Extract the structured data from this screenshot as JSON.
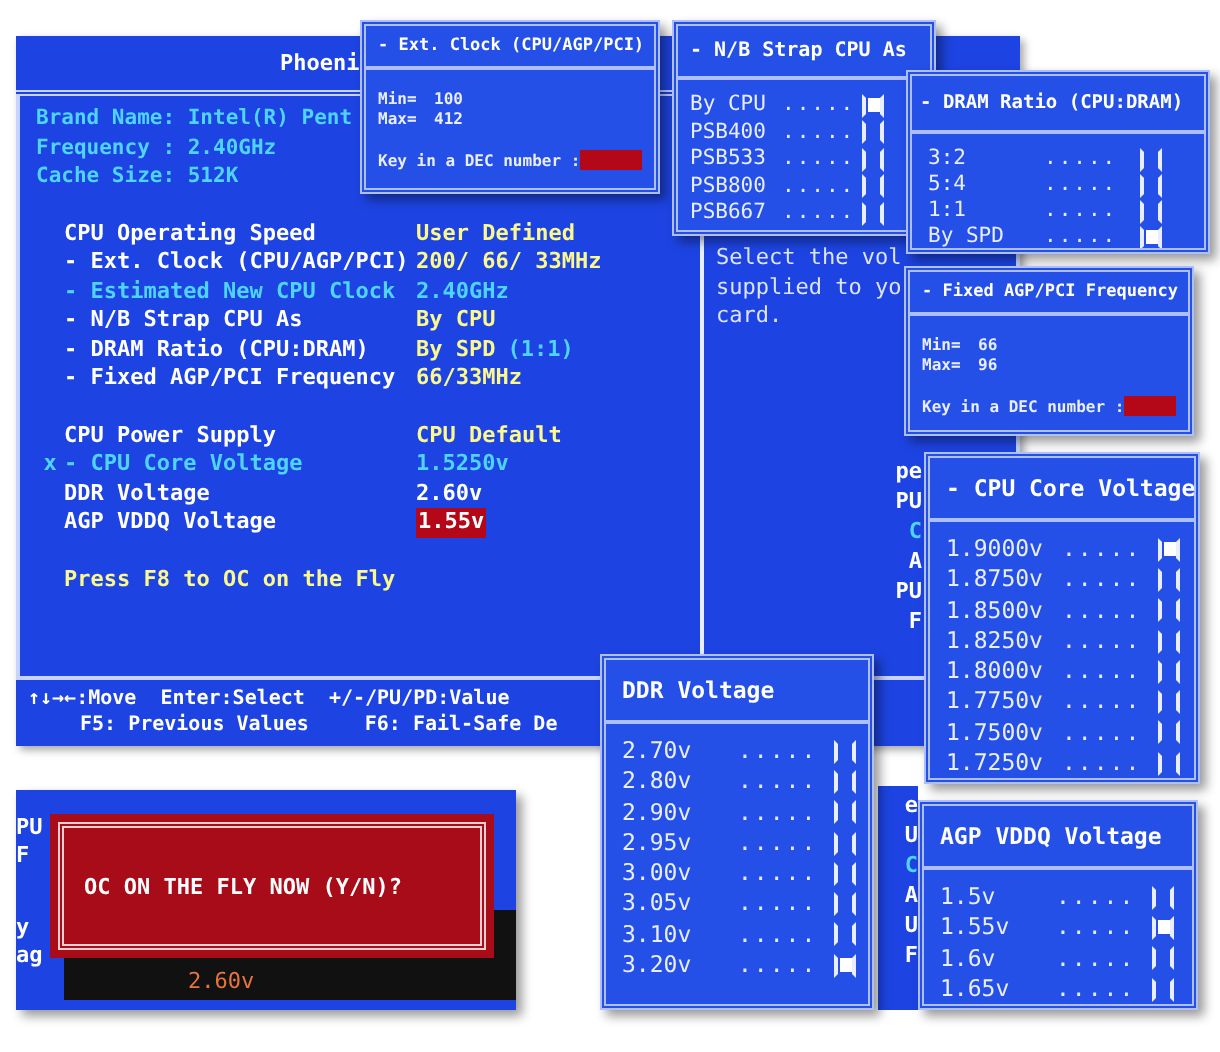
{
  "main_screen": {
    "header": "Phoeni",
    "cpu_info": [
      "Brand Name: Intel(R) Pent",
      "Frequency : 2.40GHz",
      "Cache Size:  512K"
    ],
    "settings_groups": [
      [
        {
          "label": "CPU Operating Speed",
          "value": "User Defined",
          "kind": "option",
          "disabled": false,
          "selected": false
        },
        {
          "label": "- Ext. Clock (CPU/AGP/PCI)",
          "value": "200/ 66/ 33MHz",
          "kind": "option",
          "disabled": false,
          "selected": false
        },
        {
          "label": "- Estimated New CPU Clock",
          "value": "2.40GHz",
          "kind": "option",
          "disabled": true,
          "selected": false
        },
        {
          "label": "- N/B Strap CPU As",
          "value": "By CPU",
          "kind": "option",
          "disabled": false,
          "selected": false
        },
        {
          "label": "- DRAM Ratio (CPU:DRAM)",
          "value": "By SPD",
          "note": "(1:1)",
          "kind": "option",
          "disabled": false,
          "selected": false
        },
        {
          "label": "- Fixed AGP/PCI Frequency",
          "value": "66/33MHz",
          "kind": "option",
          "disabled": false,
          "selected": false
        }
      ],
      [
        {
          "label": "CPU Power Supply",
          "value": "CPU Default",
          "kind": "option",
          "disabled": false,
          "selected": false
        },
        {
          "marker": "x",
          "label": "- CPU Core Voltage",
          "value": "1.5250v",
          "kind": "option",
          "disabled": true,
          "selected": false
        },
        {
          "label": "DDR Voltage",
          "value": "2.60v",
          "kind": "voltage",
          "disabled": false,
          "selected": false
        },
        {
          "label": "AGP VDDQ Voltage",
          "value": "1.55v",
          "kind": "voltage",
          "disabled": false,
          "selected": true
        }
      ]
    ],
    "hint": "Press F8 to OC on the Fly",
    "help_text": [
      "Select the vol",
      "supplied to yo",
      "card."
    ],
    "footer": [
      [
        "↑↓→←:Move",
        "Enter:Select",
        "+/-/PU/PD:Value"
      ],
      [
        "F5: Previous Values",
        "F6: Fail-Safe De"
      ]
    ]
  },
  "back_strips": [
    {
      "lines": [
        {
          "text": "pe",
          "disabled": false
        },
        {
          "text": "PU",
          "disabled": false
        },
        {
          "text": "C",
          "disabled": true
        },
        {
          "text": "A",
          "disabled": false
        },
        {
          "text": "PU",
          "disabled": false
        },
        {
          "text": "F",
          "disabled": false
        }
      ]
    },
    {
      "lines": [
        {
          "text": "e",
          "disabled": false
        },
        {
          "text": "U",
          "disabled": false
        },
        {
          "text": "C",
          "disabled": true
        },
        {
          "text": "A",
          "disabled": false
        },
        {
          "text": "U",
          "disabled": false
        },
        {
          "text": "F",
          "disabled": false
        }
      ]
    }
  ],
  "popups": [
    {
      "kind": "range",
      "title": "- Ext. Clock (CPU/AGP/PCI)",
      "fields": [
        {
          "label": "Min=",
          "value": "100"
        },
        {
          "label": "Max=",
          "value": "412"
        }
      ],
      "prompt": "Key in a DEC number :"
    },
    {
      "kind": "options",
      "title": "- N/B Strap CPU As",
      "options": [
        {
          "label": "By CPU",
          "leader": ".....",
          "selected": true
        },
        {
          "label": "PSB400",
          "leader": ".....",
          "selected": false
        },
        {
          "label": "PSB533",
          "leader": ".....",
          "selected": false
        },
        {
          "label": "PSB800",
          "leader": ".....",
          "selected": false
        },
        {
          "label": "PSB667",
          "leader": ".....",
          "selected": false
        }
      ]
    },
    {
      "kind": "options",
      "title": "- DRAM Ratio (CPU:DRAM)",
      "options": [
        {
          "label": "3:2",
          "leader": ".....",
          "selected": false
        },
        {
          "label": "5:4",
          "leader": ".....",
          "selected": false
        },
        {
          "label": "1:1",
          "leader": ".....",
          "selected": false
        },
        {
          "label": "By SPD",
          "leader": ".....",
          "selected": true
        }
      ]
    },
    {
      "kind": "range",
      "title": "- Fixed AGP/PCI Frequency",
      "fields": [
        {
          "label": "Min=",
          "value": "66"
        },
        {
          "label": "Max=",
          "value": "96"
        }
      ],
      "prompt": "Key in a DEC number :"
    },
    {
      "kind": "options",
      "title": "- CPU Core Voltage",
      "options": [
        {
          "label": "1.9000v",
          "leader": ".....",
          "selected": true
        },
        {
          "label": "1.8750v",
          "leader": ".....",
          "selected": false
        },
        {
          "label": "1.8500v",
          "leader": ".....",
          "selected": false
        },
        {
          "label": "1.8250v",
          "leader": ".....",
          "selected": false
        },
        {
          "label": "1.8000v",
          "leader": ".....",
          "selected": false
        },
        {
          "label": "1.7750v",
          "leader": ".....",
          "selected": false
        },
        {
          "label": "1.7500v",
          "leader": ".....",
          "selected": false
        },
        {
          "label": "1.7250v",
          "leader": ".....",
          "selected": false
        }
      ]
    },
    {
      "kind": "options",
      "title": "DDR Voltage",
      "options": [
        {
          "label": "2.70v",
          "leader": ".....",
          "selected": false
        },
        {
          "label": "2.80v",
          "leader": ".....",
          "selected": false
        },
        {
          "label": "2.90v",
          "leader": ".....",
          "selected": false
        },
        {
          "label": "2.95v",
          "leader": ".....",
          "selected": false
        },
        {
          "label": "3.00v",
          "leader": ".....",
          "selected": false
        },
        {
          "label": "3.05v",
          "leader": ".....",
          "selected": false
        },
        {
          "label": "3.10v",
          "leader": ".....",
          "selected": false
        },
        {
          "label": "3.20v",
          "leader": ".....",
          "selected": true
        }
      ]
    },
    {
      "kind": "options",
      "title": "AGP VDDQ Voltage",
      "options": [
        {
          "label": "1.5v",
          "leader": ".....",
          "selected": false
        },
        {
          "label": "1.55v",
          "leader": ".....",
          "selected": true
        },
        {
          "label": "1.6v",
          "leader": ".....",
          "selected": false
        },
        {
          "label": "1.65v",
          "leader": ".....",
          "selected": false
        }
      ]
    }
  ],
  "oc_dialog": {
    "message": "OC ON THE FLY NOW (Y/N)?",
    "side_fragments": [
      "PU",
      "F",
      "y",
      "ag"
    ],
    "value_below": "2.60v"
  }
}
